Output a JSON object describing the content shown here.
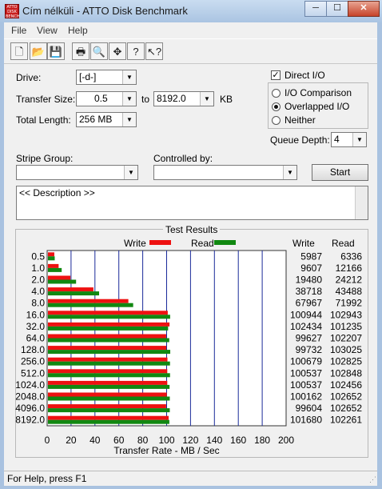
{
  "window": {
    "title": "Cím nélküli - ATTO Disk Benchmark",
    "app_icon_text": "ATTO DISK BENCH",
    "buttons": {
      "minimize": "─",
      "maximize": "☐",
      "close": "✕"
    }
  },
  "menu": [
    "File",
    "View",
    "Help"
  ],
  "toolbar": [
    "new-file",
    "open-folder",
    "save",
    "print",
    "print-preview",
    "move",
    "help",
    "context-help"
  ],
  "toolbar_glyphs": [
    "🗋",
    "📂",
    "💾",
    "🖶",
    "🔍",
    "✥",
    "?",
    "↖?"
  ],
  "settings": {
    "drive_label": "Drive:",
    "drive_value": "[-d-]",
    "transfer_size_label": "Transfer Size:",
    "transfer_from": "0.5",
    "to_label": "to",
    "transfer_to": "8192.0",
    "kb_label": "KB",
    "total_length_label": "Total Length:",
    "total_length_value": "256 MB",
    "direct_io_label": "Direct I/O",
    "direct_io_checked": true,
    "io_comparison_label": "I/O Comparison",
    "overlapped_io_label": "Overlapped I/O",
    "neither_label": "Neither",
    "selected_mode": "overlapped",
    "queue_depth_label": "Queue Depth:",
    "queue_depth_value": "4",
    "stripe_group_label": "Stripe Group:",
    "controlled_by_label": "Controlled by:",
    "start_label": "Start",
    "description_text": "<< Description >>"
  },
  "results": {
    "title": "Test Results",
    "legend_write": "Write",
    "legend_read": "Read",
    "col_write": "Write",
    "col_read": "Read",
    "write_color": "#ee1111",
    "read_color": "#118811"
  },
  "chart_data": {
    "type": "bar",
    "orientation": "horizontal",
    "xlabel": "Transfer Rate - MB / Sec",
    "xlim": [
      0,
      200
    ],
    "x_ticks": [
      "0",
      "20",
      "40",
      "60",
      "80",
      "100",
      "120",
      "140",
      "160",
      "180",
      "200"
    ],
    "grid": true,
    "categories": [
      "0.5",
      "1.0",
      "2.0",
      "4.0",
      "8.0",
      "16.0",
      "32.0",
      "64.0",
      "128.0",
      "256.0",
      "512.0",
      "1024.0",
      "2048.0",
      "4096.0",
      "8192.0"
    ],
    "series": [
      {
        "name": "Write",
        "values_kb": [
          5987,
          9607,
          19480,
          38718,
          67967,
          100944,
          102434,
          99627,
          99732,
          100679,
          100537,
          100537,
          100162,
          99604,
          101680
        ]
      },
      {
        "name": "Read",
        "values_kb": [
          6336,
          12166,
          24212,
          43488,
          71992,
          102943,
          101235,
          102207,
          103025,
          102825,
          102848,
          102456,
          102652,
          102652,
          102261
        ]
      }
    ],
    "values_mb_note_unit": "MB/s = KB/s / 1000"
  },
  "status": "For Help, press F1"
}
